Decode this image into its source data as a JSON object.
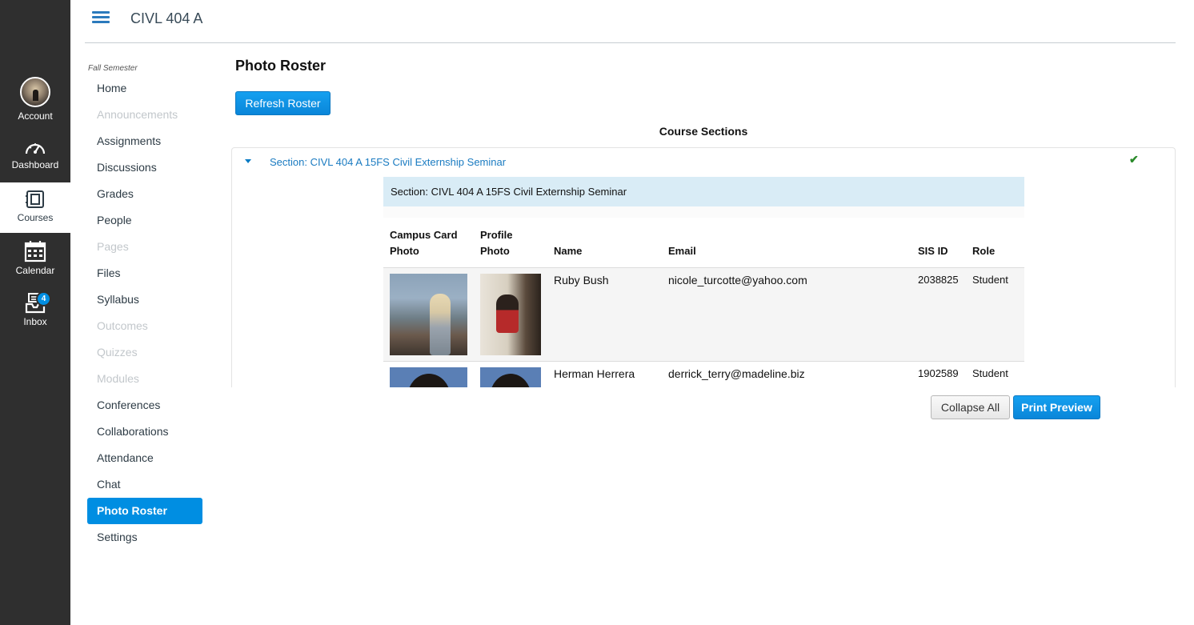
{
  "global_nav": {
    "account": "Account",
    "dashboard": "Dashboard",
    "courses": "Courses",
    "calendar": "Calendar",
    "inbox": "Inbox",
    "inbox_badge": "4"
  },
  "header": {
    "course_title": "CIVL 404 A"
  },
  "course_nav": {
    "term": "Fall Semester",
    "items": [
      {
        "label": "Home"
      },
      {
        "label": "Announcements"
      },
      {
        "label": "Assignments"
      },
      {
        "label": "Discussions"
      },
      {
        "label": "Grades"
      },
      {
        "label": "People"
      },
      {
        "label": "Pages"
      },
      {
        "label": "Files"
      },
      {
        "label": "Syllabus"
      },
      {
        "label": "Outcomes"
      },
      {
        "label": "Quizzes"
      },
      {
        "label": "Modules"
      },
      {
        "label": "Conferences"
      },
      {
        "label": "Collaborations"
      },
      {
        "label": "Attendance"
      },
      {
        "label": "Chat"
      },
      {
        "label": "Photo Roster"
      },
      {
        "label": "Settings"
      }
    ]
  },
  "main": {
    "title": "Photo Roster",
    "refresh_label": "Refresh Roster",
    "sections_heading": "Course Sections",
    "section_link": "Section: CIVL 404 A 15FS Civil Externship Seminar",
    "section_banner": "Section: CIVL 404 A 15FS Civil Externship Seminar",
    "columns": {
      "campus_1": "Campus Card",
      "campus_2": "Photo",
      "profile_1": "Profile",
      "profile_2": "Photo",
      "name": "Name",
      "email": "Email",
      "sis": "SIS ID",
      "role": "Role"
    },
    "rows": [
      {
        "name": "Ruby Bush",
        "email": "nicole_turcotte@yahoo.com",
        "sis_id": "2038825",
        "role": "Student"
      },
      {
        "name": "Herman Herrera",
        "email": "derrick_terry@madeline.biz",
        "sis_id": "1902589",
        "role": "Student"
      }
    ],
    "collapse_label": "Collapse All",
    "print_label": "Print Preview"
  }
}
